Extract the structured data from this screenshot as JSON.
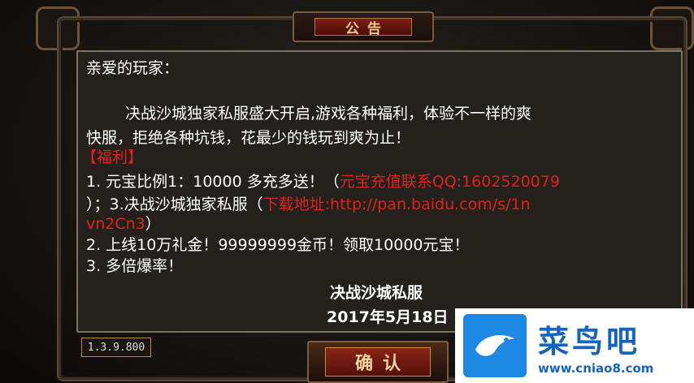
{
  "dialog": {
    "title": "公告",
    "greeting": "亲爱的玩家：",
    "intro_line1": "决战沙城独家私服盛大开启,游戏各种福利，体验不一样的爽",
    "intro_line2": "快服，拒绝各种坑钱，花最少的钱玩到爽为止！",
    "welfare_heading": "【福利】",
    "item1_part1": "1. 元宝比例1：10000  多充多送！（",
    "item1_part2": "元宝充值联系QQ:1602520079",
    "item1b_part1": "）；3.决战沙城独家私服（",
    "item1b_part2": "下载地址:http://pan.baidu.com/s/1n",
    "item1c_part1": "vn2Cn3",
    "item1c_part2": "）",
    "item2": "2. 上线10万礼金！99999999金币！领取10000元宝！",
    "item3": "3. 多倍爆率！",
    "signature_name": "决战沙城私服",
    "signature_date": "2017年5月18日",
    "version": "1.3.9.800",
    "confirm_label": "确认"
  },
  "watermark": {
    "brand": "菜鸟吧",
    "url": "www.cniao8.com"
  },
  "colors": {
    "highlight": "#e0201c",
    "text": "#ffffff",
    "panel": "#24201c",
    "brand_blue": "#1565c0"
  }
}
